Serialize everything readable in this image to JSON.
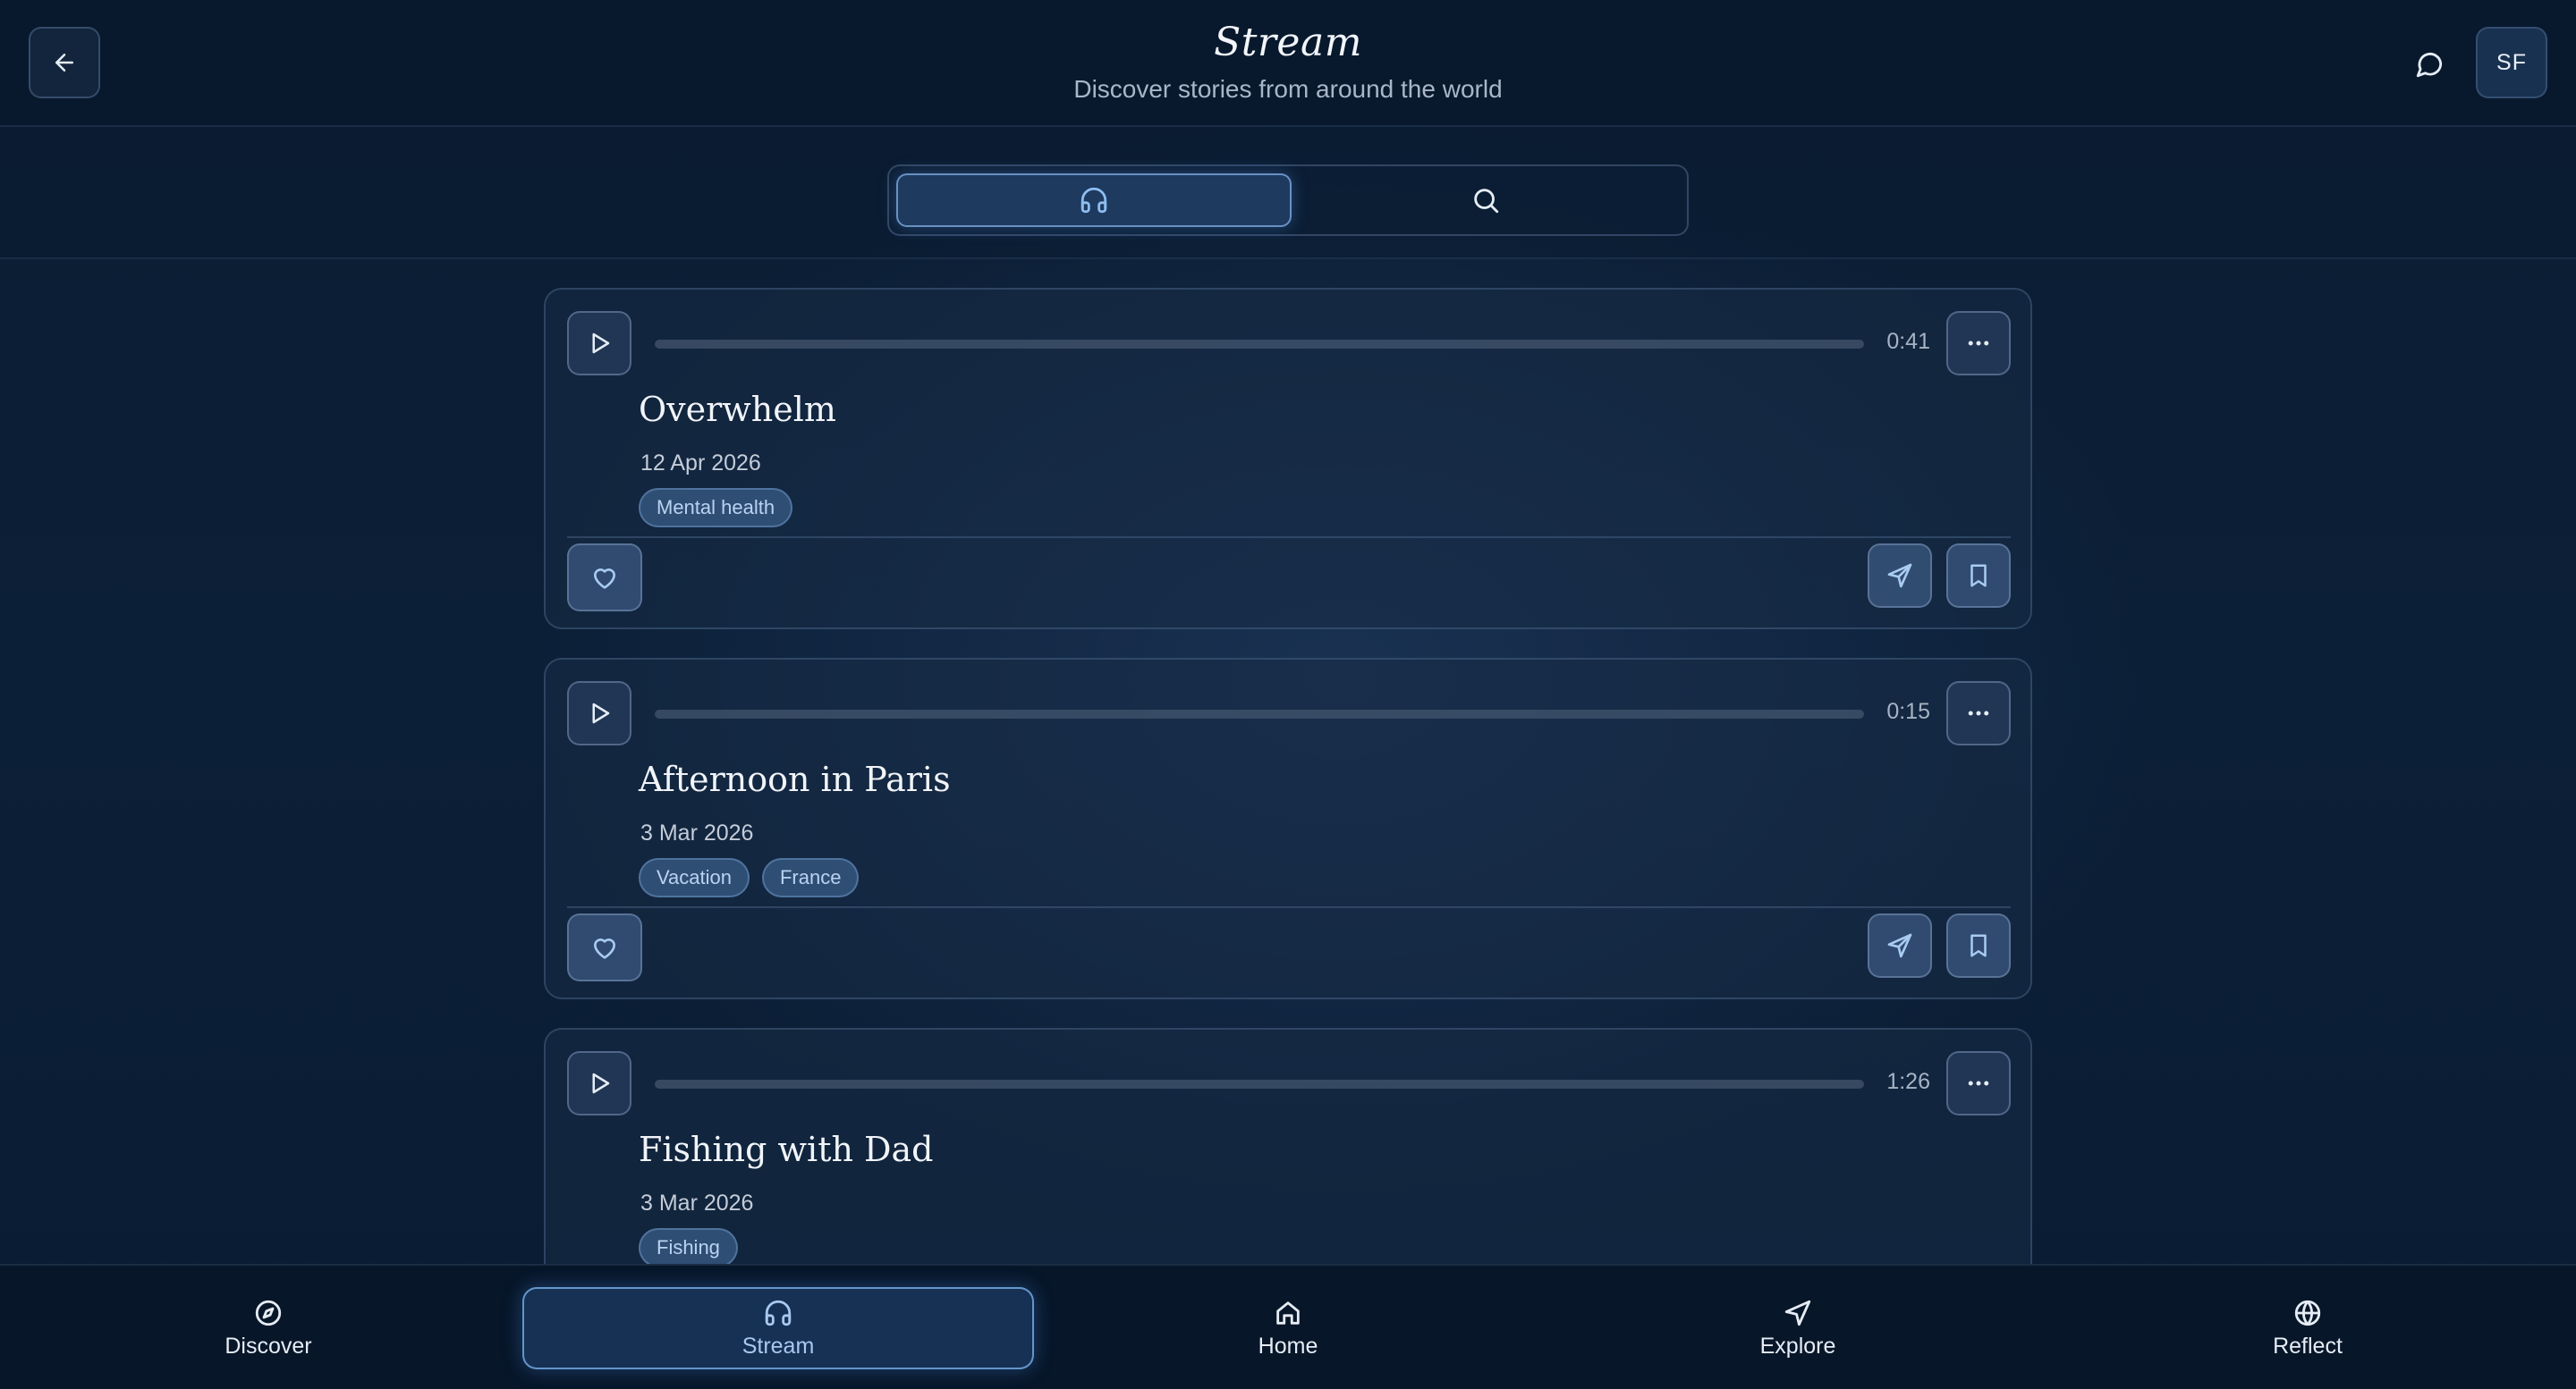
{
  "header": {
    "title": "Stream",
    "subtitle": "Discover stories from around the world",
    "avatar_initials": "SF",
    "back_icon": "arrow-left-icon",
    "chat_icon": "message-circle-icon"
  },
  "mode_toggle": {
    "options": [
      {
        "icon": "headphones-icon",
        "selected": true
      },
      {
        "icon": "search-icon",
        "selected": false
      }
    ]
  },
  "stories": [
    {
      "title": "Overwhelm",
      "date": "12 Apr 2026",
      "duration": "0:41",
      "tags": [
        "Mental health"
      ]
    },
    {
      "title": "Afternoon in Paris",
      "date": "3 Mar 2026",
      "duration": "0:15",
      "tags": [
        "Vacation",
        "France"
      ]
    },
    {
      "title": "Fishing with Dad",
      "date": "3 Mar 2026",
      "duration": "1:26",
      "tags": [
        "Fishing"
      ]
    }
  ],
  "bottom_nav": {
    "items": [
      {
        "label": "Discover",
        "icon": "compass-icon",
        "active": false
      },
      {
        "label": "Stream",
        "icon": "headphones-icon",
        "active": true
      },
      {
        "label": "Home",
        "icon": "home-icon",
        "active": false
      },
      {
        "label": "Explore",
        "icon": "navigation-icon",
        "active": false
      },
      {
        "label": "Reflect",
        "icon": "globe-icon",
        "active": false
      }
    ]
  },
  "colors": {
    "background": "#0b1d33",
    "accent": "#7fb2ec",
    "tag_text": "#b9d3f2"
  }
}
